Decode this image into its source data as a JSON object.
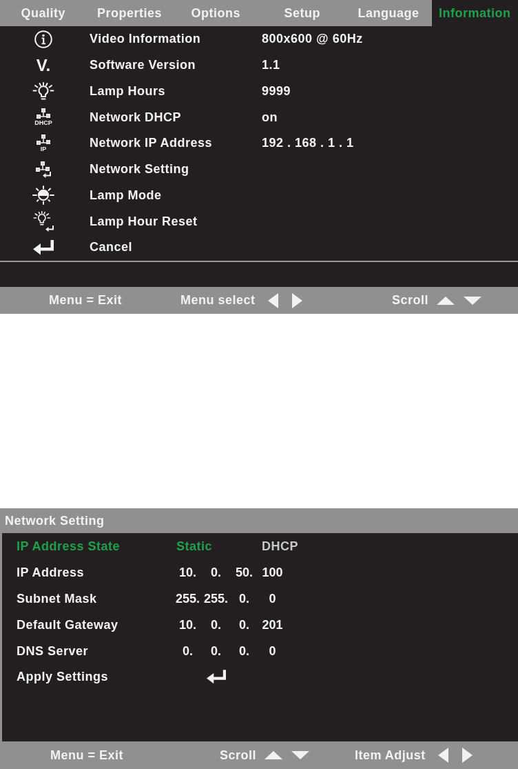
{
  "info_menu": {
    "tabs": [
      {
        "label": "Quality",
        "selected": false
      },
      {
        "label": "Properties",
        "selected": false
      },
      {
        "label": "Options",
        "selected": false
      },
      {
        "label": "Setup",
        "selected": false
      },
      {
        "label": "Language",
        "selected": false
      },
      {
        "label": "Information",
        "selected": true
      }
    ],
    "items": [
      {
        "kind": "info",
        "label": "Video Information",
        "value": "800x600 @ 60Hz"
      },
      {
        "kind": "version",
        "icon_text": "V.",
        "label": "Software Version",
        "value": "1.1"
      },
      {
        "kind": "lamp",
        "label": "Lamp Hours",
        "value": "9999"
      },
      {
        "kind": "network",
        "icon_caption": "DHCP",
        "label": "Network DHCP",
        "value": "on"
      },
      {
        "kind": "network",
        "icon_caption": "IP",
        "label": "Network IP Address",
        "value": "192 . 168 . 1 . 1"
      },
      {
        "kind": "network-enter",
        "label": "Network Setting"
      },
      {
        "kind": "lamp-mode",
        "label": "Lamp Mode"
      },
      {
        "kind": "lamp-reset",
        "label": "Lamp Hour Reset"
      },
      {
        "kind": "enter",
        "label": "Cancel"
      }
    ],
    "footer": [
      {
        "kind": "text",
        "label": "Menu = Exit"
      },
      {
        "kind": "left-right",
        "label": "Menu select"
      },
      {
        "kind": "up-down",
        "label": "Scroll"
      }
    ]
  },
  "network_setting": {
    "title": "Network Setting",
    "rows": [
      {
        "kind": "choice",
        "label": "IP Address State",
        "selected": true,
        "options": [
          {
            "label": "Static",
            "selected": true
          },
          {
            "label": "DHCP",
            "selected": false
          }
        ]
      },
      {
        "kind": "address",
        "label": "IP Address",
        "selected": false,
        "octets": [
          "10.",
          "0.",
          "50.",
          "100"
        ]
      },
      {
        "kind": "address",
        "label": "Subnet Mask",
        "selected": false,
        "octets": [
          "255.",
          "255.",
          "0.",
          "0"
        ]
      },
      {
        "kind": "address",
        "label": "Default Gateway",
        "selected": false,
        "octets": [
          "10.",
          "0.",
          "0.",
          "201"
        ]
      },
      {
        "kind": "address",
        "label": "DNS Server",
        "selected": false,
        "octets": [
          "0.",
          "0.",
          "0.",
          "0"
        ]
      },
      {
        "kind": "action",
        "label": "Apply Settings",
        "selected": false
      }
    ],
    "footer": [
      {
        "kind": "text",
        "label": "Menu = Exit"
      },
      {
        "kind": "up-down",
        "label": "Scroll"
      },
      {
        "kind": "left-right",
        "label": "Item Adjust"
      }
    ]
  }
}
